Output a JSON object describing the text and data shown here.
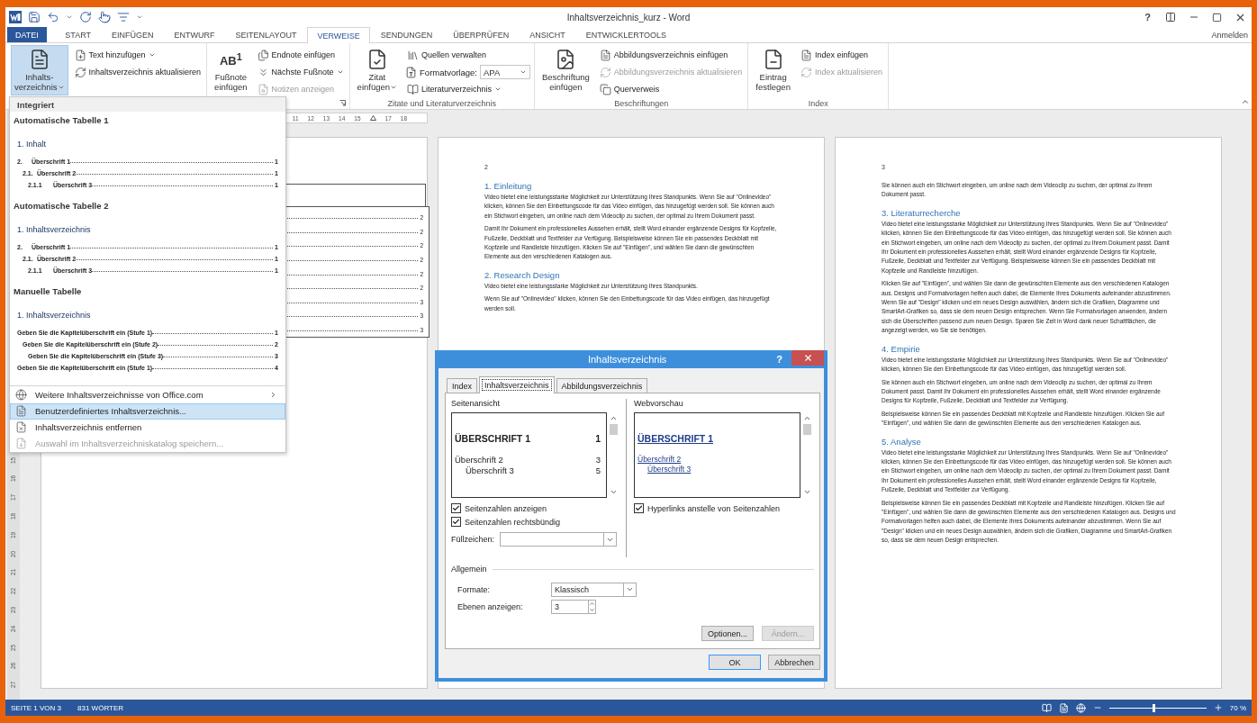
{
  "window": {
    "title": "Inhaltsverzeichnis_kurz - Word",
    "help": "?",
    "sign_in": "Anmelden"
  },
  "tabs": [
    {
      "label": "DATEI",
      "kind": "file",
      "selected": false
    },
    {
      "label": "START",
      "kind": "tab",
      "selected": false
    },
    {
      "label": "EINFÜGEN",
      "kind": "tab",
      "selected": false
    },
    {
      "label": "ENTWURF",
      "kind": "tab",
      "selected": false
    },
    {
      "label": "SEITENLAYOUT",
      "kind": "tab",
      "selected": false
    },
    {
      "label": "VERWEISE",
      "kind": "tab",
      "selected": true
    },
    {
      "label": "SENDUNGEN",
      "kind": "tab",
      "selected": false
    },
    {
      "label": "ÜBERPRÜFEN",
      "kind": "tab",
      "selected": false
    },
    {
      "label": "ANSICHT",
      "kind": "tab",
      "selected": false
    },
    {
      "label": "ENTWICKLERTOOLS",
      "kind": "tab",
      "selected": false
    }
  ],
  "ribbon": {
    "groups": [
      {
        "items": [
          {
            "kind": "large",
            "lines": [
              "Inhalts-",
              "verzeichnis"
            ],
            "dropdown": true,
            "pressed": true
          },
          {
            "kind": "column",
            "items": [
              {
                "kind": "button",
                "label": "Text hinzufügen",
                "dropdown": true,
                "disabled": false
              },
              {
                "kind": "button",
                "label": "Inhaltsverzeichnis aktualisieren",
                "dropdown": false,
                "disabled": false
              }
            ]
          }
        ]
      },
      {
        "launcher": true,
        "items": [
          {
            "kind": "large",
            "glyph": "AB$^{1}$",
            "lines": [
              "Fußnote",
              "einfügen"
            ],
            "dropdown": false,
            "pressed": false
          },
          {
            "kind": "column",
            "items": [
              {
                "kind": "button",
                "label": "Endnote einfügen",
                "dropdown": false,
                "disabled": false
              },
              {
                "kind": "button",
                "label": "Nächste Fußnote",
                "dropdown": true,
                "disabled": false
              },
              {
                "kind": "button",
                "label": "Notizen anzeigen",
                "dropdown": false,
                "disabled": true
              }
            ]
          }
        ]
      },
      {
        "label": "Zitate und Literaturverzeichnis",
        "items": [
          {
            "kind": "large",
            "lines": [
              "Zitat",
              "einfügen"
            ],
            "dropdown": true,
            "pressed": false
          },
          {
            "kind": "column",
            "items": [
              {
                "kind": "button",
                "label": "Quellen verwalten",
                "dropdown": false,
                "disabled": false
              },
              {
                "kind": "select",
                "label": "Formatvorlage:",
                "value": "APA"
              },
              {
                "kind": "button",
                "label": "Literaturverzeichnis",
                "dropdown": true,
                "disabled": false
              }
            ]
          }
        ]
      },
      {
        "label": "Beschriftungen",
        "items": [
          {
            "kind": "large",
            "lines": [
              "Beschriftung",
              "einfügen"
            ],
            "dropdown": false,
            "pressed": false
          },
          {
            "kind": "column",
            "items": [
              {
                "kind": "button",
                "label": "Abbildungsverzeichnis einfügen",
                "dropdown": false,
                "disabled": false
              },
              {
                "kind": "button",
                "label": "Abbildungsverzeichnis aktualisieren",
                "dropdown": false,
                "disabled": true
              },
              {
                "kind": "button",
                "label": "Querverweis",
                "dropdown": false,
                "disabled": false
              }
            ]
          }
        ]
      },
      {
        "label": "Index",
        "items": [
          {
            "kind": "large",
            "lines": [
              "Eintrag",
              "festlegen"
            ],
            "dropdown": false,
            "pressed": false
          },
          {
            "kind": "column",
            "items": [
              {
                "kind": "button",
                "label": "Index einfügen",
                "dropdown": false,
                "disabled": false
              },
              {
                "kind": "button",
                "label": "Index aktualisieren",
                "dropdown": false,
                "disabled": true
              }
            ]
          }
        ]
      }
    ]
  },
  "toc_menu": {
    "header": "Integriert",
    "gallery": [
      {
        "title": "Automatische Tabelle 1",
        "heading": "1. Inhalt",
        "entries": [
          {
            "number": "2.",
            "text": "Überschrift 1",
            "page": "1",
            "children": [
              {
                "number": "2.1.",
                "text": "Überschrift 2",
                "page": "1",
                "children": [
                  {
                    "number": "2.1.1",
                    "text": "Überschrift 3",
                    "page": "1"
                  }
                ]
              }
            ]
          }
        ]
      },
      {
        "title": "Automatische Tabelle 2",
        "heading": "1. Inhaltsverzeichnis",
        "entries": [
          {
            "number": "2.",
            "text": "Überschrift 1",
            "page": "1",
            "children": [
              {
                "number": "2.1.",
                "text": "Überschrift 2",
                "page": "1",
                "children": [
                  {
                    "number": "2.1.1",
                    "text": "Überschrift 3",
                    "page": "1"
                  }
                ]
              }
            ]
          }
        ]
      },
      {
        "title": "Manuelle Tabelle",
        "heading": "1. Inhaltsverzeichnis",
        "entries": [
          {
            "text": "Geben Sie die Kapitelüberschrift ein (Stufe 1)",
            "page": "1",
            "children": [
              {
                "text": "Geben Sie die Kapitelüberschrift ein (Stufe 2)",
                "page": "2",
                "children": [
                  {
                    "text": "Geben Sie die Kapitelüberschrift ein (Stufe 3)",
                    "page": "3"
                  }
                ]
              }
            ]
          },
          {
            "text": "Geben Sie die Kapitelüberschrift ein (Stufe 1)",
            "page": "4"
          }
        ]
      }
    ],
    "items": [
      {
        "label": "Weitere Inhaltsverzeichnisse von Office.com",
        "selected": false,
        "disabled": false,
        "submenu": true
      },
      {
        "label": "Benutzerdefiniertes Inhaltsverzeichnis...",
        "selected": true,
        "disabled": false,
        "submenu": false
      },
      {
        "label": "Inhaltsverzeichnis entfernen",
        "selected": false,
        "disabled": false,
        "submenu": false
      },
      {
        "label": "Auswahl im Inhaltsverzeichniskatalog speichern...",
        "selected": false,
        "disabled": true,
        "submenu": false
      }
    ]
  },
  "document": {
    "ruler": [
      {
        "kind": "number",
        "text": "11"
      },
      {
        "kind": "number",
        "text": "12"
      },
      {
        "kind": "number",
        "text": "13"
      },
      {
        "kind": "number",
        "text": "14"
      },
      {
        "kind": "number",
        "text": "15"
      },
      {
        "kind": "marker"
      },
      {
        "kind": "number",
        "text": "17"
      },
      {
        "kind": "number",
        "text": "18"
      }
    ],
    "vertical_ruler": [
      "15",
      "16",
      "17",
      "18",
      "19",
      "20",
      "21",
      "22",
      "23",
      "24",
      "25",
      "26",
      "27"
    ],
    "pages": [
      {
        "kind": "toc_fragment",
        "toc_pages": [
          "2",
          "2",
          "2",
          "2",
          "2",
          "2",
          "3",
          "3",
          "3"
        ]
      },
      {
        "kind": "text",
        "number": "2",
        "blocks": [
          {
            "kind": "heading",
            "text": "1. Einleitung"
          },
          {
            "kind": "paragraph",
            "text": "Video bietet eine leistungsstarke Möglichkeit zur Unterstützung Ihres Standpunkts. Wenn Sie auf \"Onlinevideo\" klicken, können Sie den Einbettungscode für das Video einfügen, das hinzugefügt werden soll. Sie können auch ein Stichwort eingeben, um online nach dem Videoclip zu suchen, der optimal zu Ihrem Dokument passt."
          },
          {
            "kind": "paragraph",
            "text": "Damit Ihr Dokument ein professionelles Aussehen erhält, stellt Word einander ergänzende Designs für Kopfzeile, Fußzeile, Deckblatt und Textfelder zur Verfügung. Beispielsweise können Sie ein passendes Deckblatt mit Kopfzeile und Randleiste hinzufügen. Klicken Sie auf \"Einfügen\", und wählen Sie dann die gewünschten Elemente aus den verschiedenen Katalogen aus."
          },
          {
            "kind": "heading",
            "text": "2. Research Design"
          },
          {
            "kind": "paragraph",
            "text": "Video bietet eine leistungsstarke Möglichkeit zur Unterstützung Ihres Standpunkts."
          },
          {
            "kind": "paragraph",
            "text": "Wenn Sie auf \"Onlinevideo\" klicken, können Sie den Einbettungscode für das Video einfügen, das hinzugefügt werden soll."
          }
        ]
      },
      {
        "kind": "text",
        "number": "3",
        "blocks": [
          {
            "kind": "paragraph",
            "text": "Sie können auch ein Stichwort eingeben, um online nach dem Videoclip zu suchen, der optimal zu Ihrem Dokument passt."
          },
          {
            "kind": "heading",
            "text": "3. Literaturrecherche"
          },
          {
            "kind": "paragraph",
            "text": "Video bietet eine leistungsstarke Möglichkeit zur Unterstützung Ihres Standpunkts. Wenn Sie auf \"Onlinevideo\" klicken, können Sie den Einbettungscode für das Video einfügen, das hinzugefügt werden soll. Sie können auch ein Stichwort eingeben, um online nach dem Videoclip zu suchen, der optimal zu Ihrem Dokument passt. Damit Ihr Dokument ein professionelles Aussehen erhält, stellt Word einander ergänzende Designs für Kopfzeile, Fußzeile, Deckblatt und Textfelder zur Verfügung. Beispielsweise können Sie ein passendes Deckblatt mit Kopfzeile und Randleiste hinzufügen."
          },
          {
            "kind": "paragraph",
            "text": "Klicken Sie auf \"Einfügen\", und wählen Sie dann die gewünschten Elemente aus den verschiedenen Katalogen aus. Designs und Formatvorlagen helfen auch dabei, die Elemente Ihres Dokuments aufeinander abzustimmen. Wenn Sie auf \"Design\" klicken und ein neues Design auswählen, ändern sich die Grafiken, Diagramme und SmartArt-Grafiken so, dass sie dem neuen Design entsprechen. Wenn Sie Formatvorlagen anwenden, ändern sich die Überschriften passend zum neuen Design. Sparen Sie Zeit in Word dank neuer Schaltflächen, die angezeigt werden, wo Sie sie benötigen."
          },
          {
            "kind": "heading",
            "text": "4. Empirie"
          },
          {
            "kind": "paragraph",
            "text": "Video bietet eine leistungsstarke Möglichkeit zur Unterstützung Ihres Standpunkts. Wenn Sie auf \"Onlinevideo\" klicken, können Sie den Einbettungscode für das Video einfügen, das hinzugefügt werden soll."
          },
          {
            "kind": "paragraph",
            "text": "Sie können auch ein Stichwort eingeben, um online nach dem Videoclip zu suchen, der optimal zu Ihrem Dokument passt. Damit Ihr Dokument ein professionelles Aussehen erhält, stellt Word einander ergänzende Designs für Kopfzeile, Fußzeile, Deckblatt und Textfelder zur Verfügung."
          },
          {
            "kind": "paragraph",
            "text": "Beispielsweise können Sie ein passendes Deckblatt mit Kopfzeile und Randleiste hinzufügen. Klicken Sie auf \"Einfügen\", und wählen Sie dann die gewünschten Elemente aus den verschiedenen Katalogen aus."
          },
          {
            "kind": "heading",
            "text": "5. Analyse"
          },
          {
            "kind": "paragraph",
            "text": "Video bietet eine leistungsstarke Möglichkeit zur Unterstützung Ihres Standpunkts. Wenn Sie auf \"Onlinevideo\" klicken, können Sie den Einbettungscode für das Video einfügen, das hinzugefügt werden soll. Sie können auch ein Stichwort eingeben, um online nach dem Videoclip zu suchen, der optimal zu Ihrem Dokument passt. Damit Ihr Dokument ein professionelles Aussehen erhält, stellt Word einander ergänzende Designs für Kopfzeile, Fußzeile, Deckblatt und Textfelder zur Verfügung."
          },
          {
            "kind": "paragraph",
            "text": "Beispielsweise können Sie ein passendes Deckblatt mit Kopfzeile und Randleiste hinzufügen. Klicken Sie auf \"Einfügen\", und wählen Sie dann die gewünschten Elemente aus den verschiedenen Katalogen aus. Designs und Formatvorlagen helfen auch dabei, die Elemente Ihres Dokuments aufeinander abzustimmen. Wenn Sie auf \"Design\" klicken und ein neues Design auswählen, ändern sich die Grafiken, Diagramme und SmartArt-Grafiken so, dass sie dem neuen Design entsprechen."
          }
        ]
      }
    ]
  },
  "dialog": {
    "title": "Inhaltsverzeichnis",
    "help": "?",
    "tabs": [
      {
        "label": "Index",
        "selected": false
      },
      {
        "label": "Inhaltsverzeichnis",
        "selected": true
      },
      {
        "label": "Abbildungsverzeichnis",
        "selected": false
      }
    ],
    "print_preview": {
      "label": "Seitenansicht",
      "entries": [
        {
          "text": "ÜBERSCHRIFT 1",
          "page": "1",
          "children": [
            {
              "text": "Überschrift 2",
              "page": "3",
              "children": [
                {
                  "text": "Überschrift 3",
                  "page": "5"
                }
              ]
            }
          ]
        }
      ],
      "checkboxes": [
        {
          "label": "Seitenzahlen anzeigen",
          "checked": true
        },
        {
          "label": "Seitenzahlen rechtsbündig",
          "checked": true
        }
      ],
      "fill_label": "Füllzeichen:"
    },
    "web_preview": {
      "label": "Webvorschau",
      "entries": [
        {
          "text": "ÜBERSCHRIFT 1",
          "children": [
            {
              "text": "Überschrift 2",
              "children": [
                {
                  "text": "Überschrift 3"
                }
              ]
            }
          ]
        }
      ],
      "checkboxes": [
        {
          "label": "Hyperlinks anstelle von Seitenzahlen",
          "checked": true
        }
      ]
    },
    "general": {
      "label": "Allgemein",
      "fields": [
        {
          "kind": "select",
          "label": "Formate:",
          "value": "Klassisch"
        },
        {
          "kind": "spin",
          "label": "Ebenen anzeigen:",
          "value": "3"
        }
      ]
    },
    "panel_buttons": [
      {
        "label": "Optionen...",
        "disabled": false
      },
      {
        "label": "Ändern...",
        "disabled": true
      }
    ],
    "buttons": [
      {
        "label": "OK",
        "default": true
      },
      {
        "label": "Abbrechen",
        "default": false
      }
    ]
  },
  "status_bar": {
    "page": "SEITE 1 VON 3",
    "words": "831 WÖRTER",
    "zoom": "70 %",
    "zoom_slider": {
      "level": 0.46
    }
  }
}
